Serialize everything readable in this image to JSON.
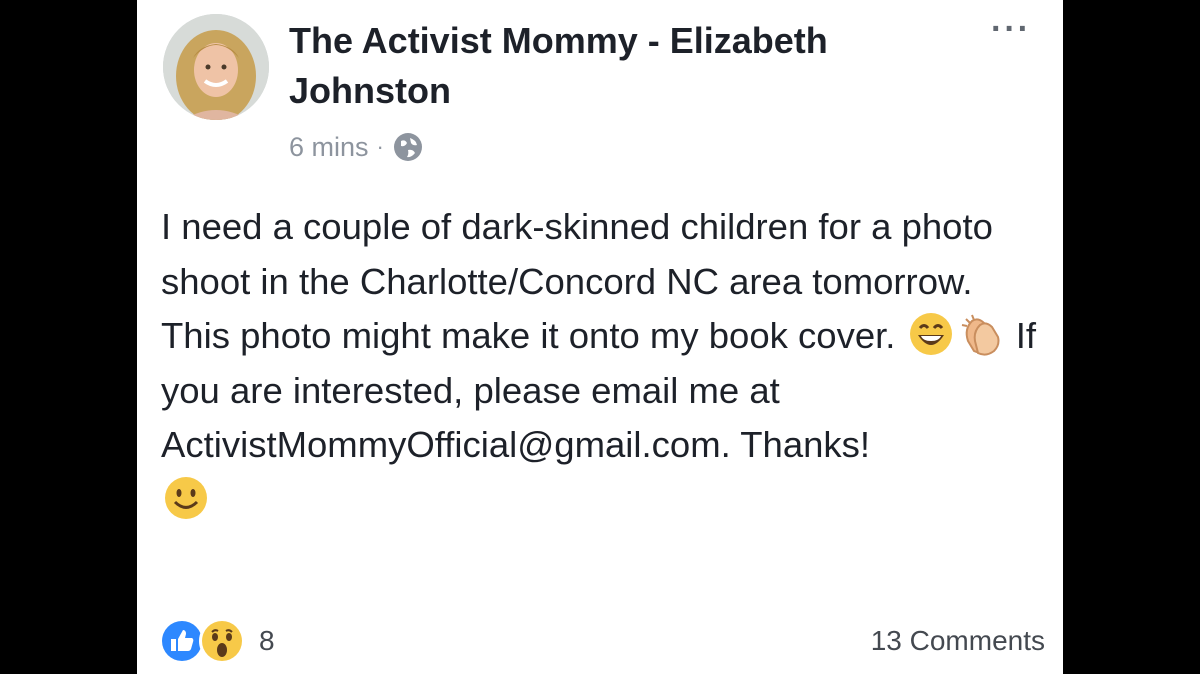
{
  "post": {
    "author": "The Activist Mommy - Elizabeth Johnston",
    "timestamp": "6 mins",
    "separator": "·",
    "privacy_icon": "globe-icon",
    "more_label": "···",
    "body": {
      "part1": "I need a couple of dark-skinned children for a photo shoot in the Charlotte/Concord NC area tomorrow. This photo might make it onto my book cover.",
      "emoji1": "grinning-face-icon",
      "emoji2": "clapping-hands-icon",
      "part2": "If you are interested, please email me at ActivistMommyOfficial@gmail.com. Thanks!",
      "emoji3": "smiling-face-icon"
    }
  },
  "footer": {
    "reaction_icons": [
      "like-icon",
      "wow-icon"
    ],
    "reaction_count": "8",
    "comments_label": "13 Comments"
  },
  "colors": {
    "like_blue": "#2d88ff",
    "emoji_yellow": "#f7c948",
    "text": "#1d2129",
    "meta_gray": "#8d949e"
  }
}
